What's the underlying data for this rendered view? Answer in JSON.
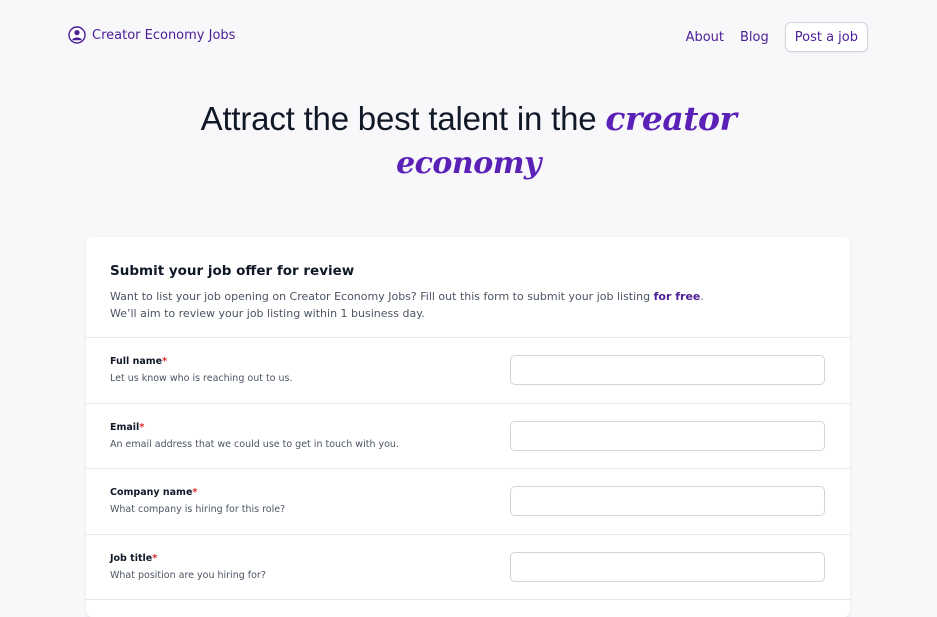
{
  "nav": {
    "brand": "Creator Economy Jobs",
    "brand_icon": "creator-avatar-icon",
    "about": "About",
    "blog": "Blog",
    "post_job": "Post a job"
  },
  "hero": {
    "line1_prefix": "Attract the best talent in the",
    "accent1": "creator",
    "accent2": "economy"
  },
  "form": {
    "title": "Submit your job offer for review",
    "desc_part1": "Want to list your job opening on Creator Economy Jobs? Fill out this form to submit your job listing",
    "desc_free": "for free",
    "desc_part2": ".",
    "desc_line2": "We’ll aim to review your job listing within 1 business day.",
    "fields": [
      {
        "label": "Full name",
        "required": "*",
        "help": "Let us know who is reaching out to us.",
        "value": "",
        "placeholder": ""
      },
      {
        "label": "Email",
        "required": "*",
        "help": "An email address that we could use to get in touch with you.",
        "value": "",
        "placeholder": ""
      },
      {
        "label": "Company name",
        "required": "*",
        "help": "What company is hiring for this role?",
        "value": "",
        "placeholder": ""
      },
      {
        "label": "Job title",
        "required": "*",
        "help": "What position are you hiring for?",
        "value": "",
        "placeholder": ""
      }
    ]
  },
  "colors": {
    "accent": "#5b21b6",
    "link": "#4c1d95",
    "required": "#dc2626",
    "background": "#f8f8fb"
  }
}
